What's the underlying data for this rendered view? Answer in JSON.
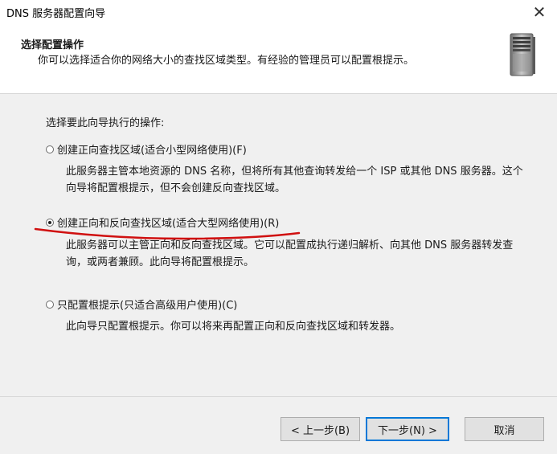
{
  "window": {
    "title": "DNS 服务器配置向导",
    "close_glyph": "✕"
  },
  "header": {
    "title": "选择配置操作",
    "description": "你可以选择适合你的网络大小的查找区域类型。有经验的管理员可以配置根提示。"
  },
  "main": {
    "prompt": "选择要此向导执行的操作:",
    "options": [
      {
        "label": "创建正向查找区域(适合小型网络使用)(F)",
        "selected": false,
        "description": "此服务器主管本地资源的 DNS 名称，但将所有其他查询转发给一个 ISP 或其他 DNS 服务器。这个向导将配置根提示，但不会创建反向查找区域。"
      },
      {
        "label": "创建正向和反向查找区域(适合大型网络使用)(R)",
        "selected": true,
        "description": "此服务器可以主管正向和反向查找区域。它可以配置成执行递归解析、向其他 DNS 服务器转发查询，或两者兼顾。此向导将配置根提示。"
      },
      {
        "label": "只配置根提示(只适合高级用户使用)(C)",
        "selected": false,
        "description": "此向导只配置根提示。你可以将来再配置正向和反向查找区域和转发器。"
      }
    ]
  },
  "footer": {
    "back_label": "< 上一步(B)",
    "next_label": "下一步(N) >",
    "cancel_label": "取消"
  },
  "colors": {
    "accent": "#0078d7",
    "annotation": "#d01010"
  },
  "icons": {
    "server": "server-tower-icon",
    "close": "close-icon"
  }
}
